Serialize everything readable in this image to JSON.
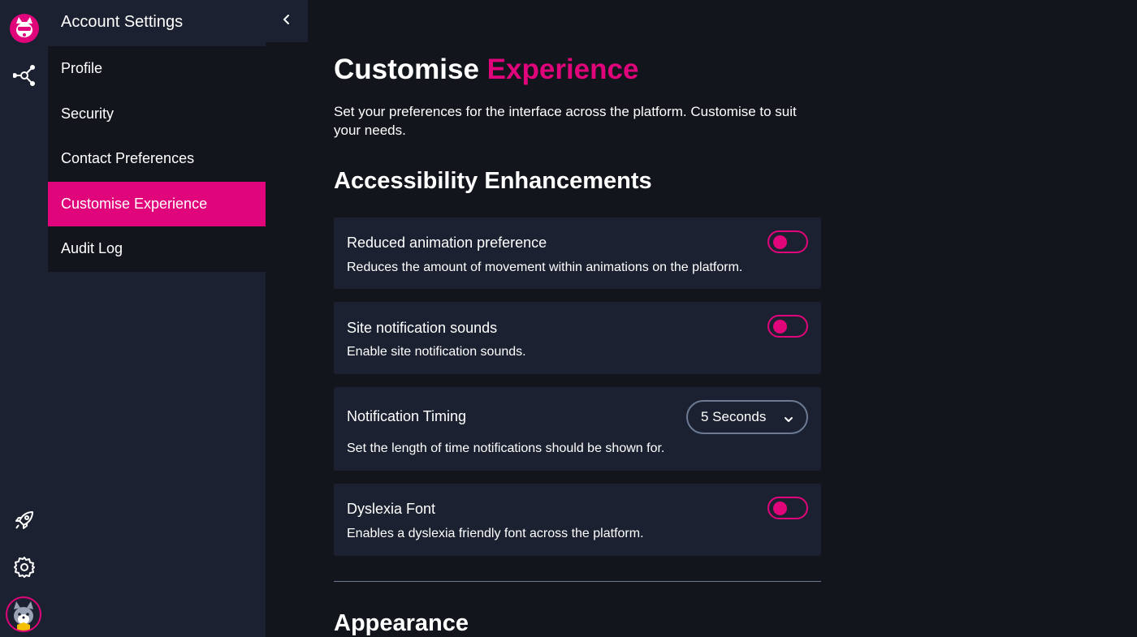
{
  "sidebar": {
    "title": "Account Settings",
    "items": [
      {
        "label": "Profile"
      },
      {
        "label": "Security"
      },
      {
        "label": "Contact Preferences"
      },
      {
        "label": "Customise Experience",
        "active": true
      },
      {
        "label": "Audit Log"
      }
    ]
  },
  "rail": {
    "icons": [
      "logo-icon",
      "hub-icon",
      "rocket-icon",
      "gear-icon",
      "avatar"
    ]
  },
  "page": {
    "title_part1": "Customise",
    "title_part2": "Experience",
    "intro": "Set your preferences for the interface across the platform. Customise to suit your needs."
  },
  "accessibility": {
    "heading": "Accessibility Enhancements",
    "settings": [
      {
        "title": "Reduced animation preference",
        "desc": "Reduces the amount of movement within animations on the platform.",
        "control": "toggle",
        "on": false
      },
      {
        "title": "Site notification sounds",
        "desc": "Enable site notification sounds.",
        "control": "toggle",
        "on": false
      },
      {
        "title": "Notification Timing",
        "desc": "Set the length of time notifications should be shown for.",
        "control": "select",
        "value": "5 Seconds"
      },
      {
        "title": "Dyslexia Font",
        "desc": "Enables a dyslexia friendly font across the platform.",
        "control": "toggle",
        "on": false
      }
    ]
  },
  "appearance": {
    "heading": "Appearance"
  },
  "colors": {
    "accent": "#e0057b",
    "panel": "#1b2130",
    "background": "#12151c",
    "border": "#6b7b96"
  }
}
